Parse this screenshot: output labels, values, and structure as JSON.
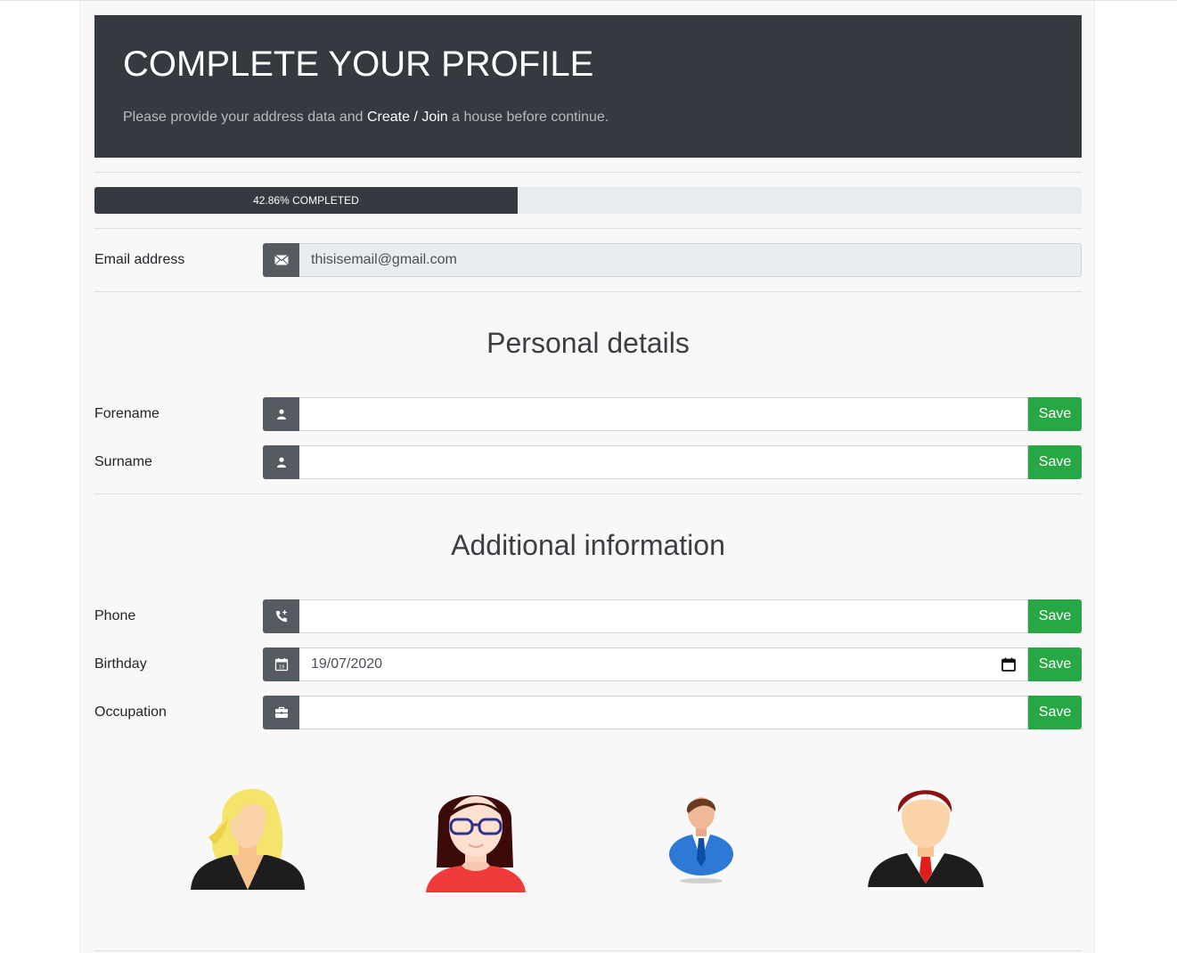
{
  "hero": {
    "title": "COMPLETE YOUR PROFILE",
    "subtitle_pre": "Please provide your address data and ",
    "subtitle_create": "Create",
    "subtitle_sep": " / ",
    "subtitle_join": "Join",
    "subtitle_post": " a house before continue."
  },
  "progress": {
    "value": 42.86,
    "label": "42.86% COMPLETED"
  },
  "email": {
    "label": "Email address",
    "value": "thisisemail@gmail.com",
    "icon": "envelope-icon"
  },
  "personal": {
    "title": "Personal details",
    "forename": {
      "label": "Forename",
      "value": "",
      "icon": "user-icon",
      "save": "Save"
    },
    "surname": {
      "label": "Surname",
      "value": "",
      "icon": "user-icon",
      "save": "Save"
    }
  },
  "additional": {
    "title": "Additional information",
    "phone": {
      "label": "Phone",
      "value": "",
      "icon": "phone-plus-icon",
      "save": "Save"
    },
    "birthday": {
      "label": "Birthday",
      "value": "19/07/2020",
      "icon": "calendar-icon",
      "save": "Save"
    },
    "occupation": {
      "label": "Occupation",
      "value": "",
      "icon": "briefcase-icon",
      "save": "Save"
    }
  },
  "avatars": [
    "blonde-woman-avatar",
    "glasses-woman-avatar",
    "businessman-blue-avatar",
    "businessman-red-tie-avatar"
  ],
  "colors": {
    "dark": "#343a40",
    "icon_bg": "#555b61",
    "save": "#28a745",
    "progress_track": "#e9ecef"
  }
}
